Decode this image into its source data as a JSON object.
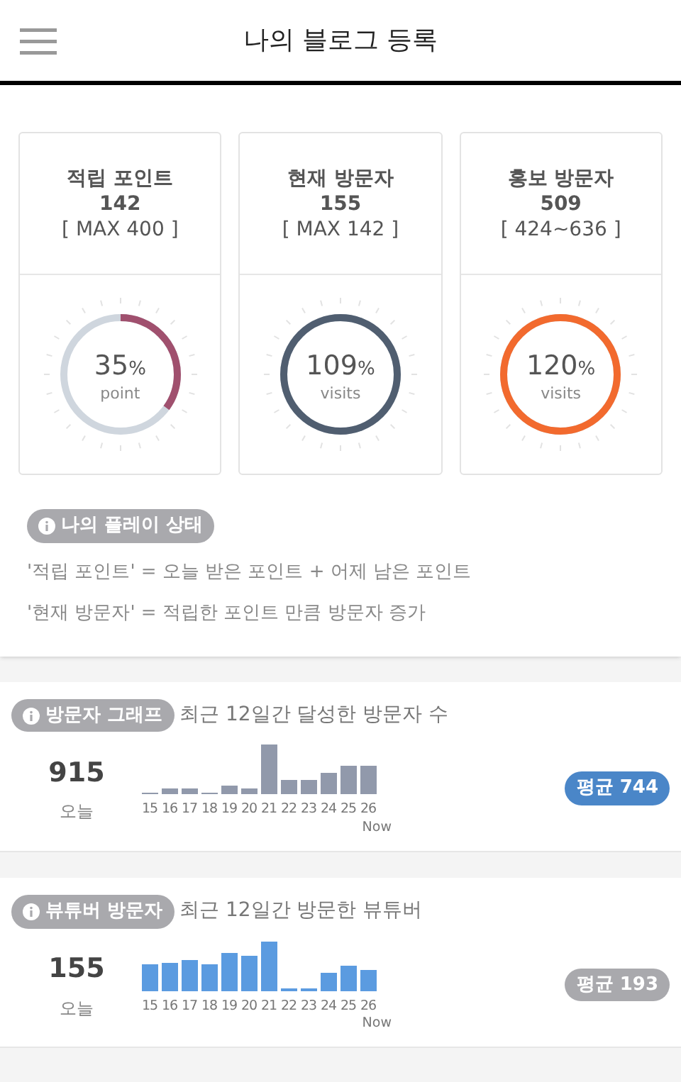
{
  "header": {
    "title": "나의 블로그 등록"
  },
  "stats": [
    {
      "title": "적립 포인트",
      "value": "142",
      "range": "[ MAX 400 ]",
      "percent": "35",
      "unit": "%",
      "caption": "point",
      "color": "#a0506e"
    },
    {
      "title": "현재 방문자",
      "value": "155",
      "range": "[ MAX 142 ]",
      "percent": "109",
      "unit": "%",
      "caption": "visits",
      "color": "#505e70"
    },
    {
      "title": "홍보 방문자",
      "value": "509",
      "range": "[ 424~636 ]",
      "percent": "120",
      "unit": "%",
      "caption": "visits",
      "color": "#f26a2e"
    }
  ],
  "info": {
    "badge": "나의 플레이 상태",
    "lines": [
      "'적립 포인트' = 오늘 받은 포인트 + 어제 남은 포인트",
      "'현재 방문자' = 적립한 포인트 만큼 방문자 증가"
    ]
  },
  "graphs": [
    {
      "badge": "방문자 그래프",
      "description": "최근 12일간 달성한 방문자 수",
      "today_value": "915",
      "today_label": "오늘",
      "x_labels": [
        "15",
        "16",
        "17",
        "18",
        "19",
        "20",
        "21",
        "22",
        "23",
        "24",
        "25",
        "26"
      ],
      "now_label": "Now",
      "color": "#9199ab",
      "average": {
        "text": "평균 744",
        "color": "#4a86c8"
      }
    },
    {
      "badge": "뷰튜버 방문자",
      "description": "최근 12일간 방문한 뷰튜버",
      "today_value": "155",
      "today_label": "오늘",
      "x_labels": [
        "15",
        "16",
        "17",
        "18",
        "19",
        "20",
        "21",
        "22",
        "23",
        "24",
        "25",
        "26"
      ],
      "now_label": "Now",
      "color": "#5b9be0",
      "average": {
        "text": "평균 193",
        "color": "#a9a9ad"
      }
    }
  ]
}
